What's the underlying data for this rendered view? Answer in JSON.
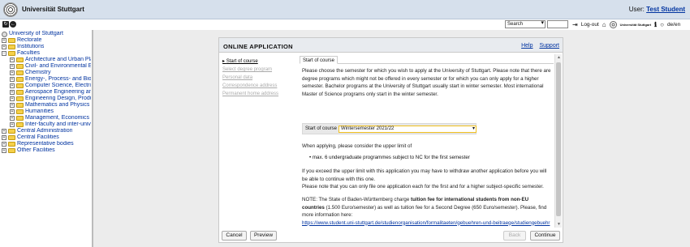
{
  "header": {
    "university": "Universität Stuttgart",
    "user_label": "User:",
    "user_name": "Test Student"
  },
  "toolbar": {
    "search_select": "Search",
    "logout_label": "Log-out",
    "mini_brand": "Universität Stuttgart",
    "language_label": "de/en"
  },
  "tree": {
    "root": "University of Stuttgart",
    "items": [
      {
        "label": "Rectorate",
        "level": 0
      },
      {
        "label": "Institutions",
        "level": 0
      },
      {
        "label": "Faculties",
        "level": 0
      },
      {
        "label": "Architecture and Urban Pla",
        "level": 1
      },
      {
        "label": "Civil- and Environmental Er",
        "level": 1
      },
      {
        "label": "Chemistry",
        "level": 1
      },
      {
        "label": "Energy-, Process- and Bio-",
        "level": 1
      },
      {
        "label": "Computer Science, Electric",
        "level": 1
      },
      {
        "label": "Aerospace Engineering and",
        "level": 1
      },
      {
        "label": "Engineering Design, Produc",
        "level": 1
      },
      {
        "label": "Mathematics and Physics",
        "level": 1
      },
      {
        "label": "Humanities",
        "level": 1
      },
      {
        "label": "Management, Economics a",
        "level": 1
      },
      {
        "label": "Inter-faculty and inter-unive",
        "level": 1
      },
      {
        "label": "Central Administration",
        "level": 0
      },
      {
        "label": "Central Facilities",
        "level": 0
      },
      {
        "label": "Representative bodies",
        "level": 0
      },
      {
        "label": "Other Facilities",
        "level": 0
      }
    ]
  },
  "dialog": {
    "title": "Online application",
    "help": "Help",
    "support": "Support",
    "steps": [
      "Start of course",
      "Select degree program",
      "Personal data",
      "Correspondence address",
      "Permanent home address"
    ],
    "tab": "Start of course",
    "intro": "Please choose the semester for which you wish to apply at the University of Stuttgart. Please note that there are degree programs which might not be offered in every semester or for which you can only apply for a higher semester. Bachelor programs at the University of Stuttgart usually start in winter semester. Most international Master of Science programs only start in the winter semester.",
    "select_label": "Start of course",
    "select_value": "Wintersemester 2021/22",
    "limit_text": "When applying, please consider the upper limit of",
    "bullet": "max. 6 undergraduate programmes subject to NC for the first semester",
    "exceed_text": "If you exceed the upper limit with this application you may have to withdraw another application before you will be able to continue with this one.",
    "only_one_text": "Please note that you can only file one application each for the first and for a higher subject-specific semester.",
    "note_prefix": "NOTE: The State of Baden-Württemberg charge ",
    "note_bold": "tuition fee for international students from non-EU countries",
    "note_rest": " (1.500 Euro/semester) as well as tuition fee for a Second Degree (650 Euro/semester). Please, find more information here:",
    "note_link": "https://www.student.uni-stuttgart.de/studienorganisation/formalitaeten/gebuehren-und-beitraege/studiengebuehren/",
    "buttons": {
      "cancel": "Cancel",
      "preview": "Preview",
      "back": "Back",
      "continue": "Continue"
    }
  }
}
